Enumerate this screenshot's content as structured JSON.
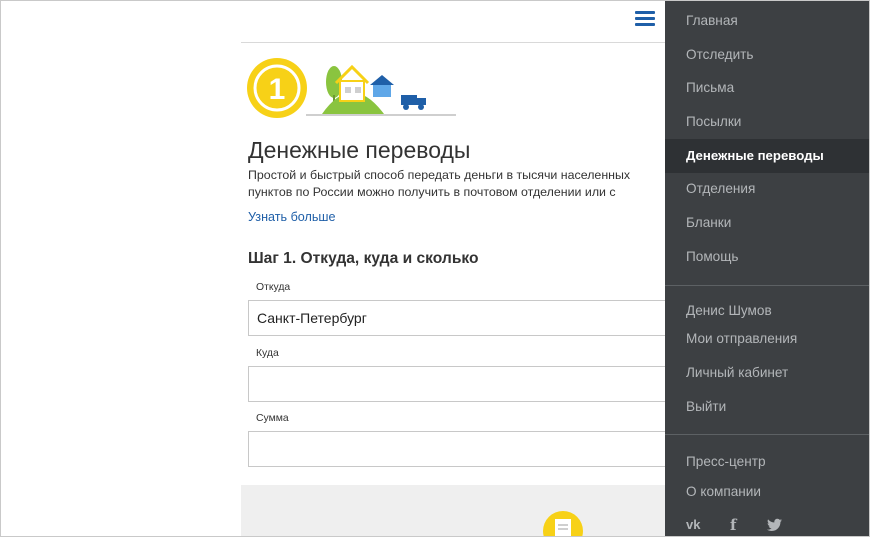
{
  "page": {
    "title": "Денежные переводы",
    "description": "Простой и быстрый способ передать деньги в тысячи населенных пунктов по России можно получить в почтовом отделении или с доставкой на дом",
    "learn_more": "Узнать больше",
    "step_heading": "Шаг 1. Откуда, куда и сколько"
  },
  "form": {
    "from": {
      "label": "Откуда",
      "value": "Санкт-Петербург",
      "placeholder": ""
    },
    "to": {
      "label": "Куда",
      "value": "",
      "placeholder": ""
    },
    "amount": {
      "label": "Сумма",
      "value": "",
      "placeholder": ""
    }
  },
  "hero": {
    "coin_digit": "1"
  },
  "nav": {
    "main_items": [
      {
        "label": "Главная",
        "active": false
      },
      {
        "label": "Отследить",
        "active": false
      },
      {
        "label": "Письма",
        "active": false
      },
      {
        "label": "Посылки",
        "active": false
      },
      {
        "label": "Денежные переводы",
        "active": true
      },
      {
        "label": "Отделения",
        "active": false
      },
      {
        "label": "Бланки",
        "active": false
      },
      {
        "label": "Помощь",
        "active": false
      }
    ],
    "user_items": [
      {
        "label": "Денис Шумов"
      },
      {
        "label": "Мои отправления"
      },
      {
        "label": "Личный кабинет"
      },
      {
        "label": "Выйти"
      }
    ],
    "info_items": [
      {
        "label": "Пресс-центр"
      },
      {
        "label": "О компании"
      }
    ],
    "social": {
      "vk": "vk",
      "facebook": "f"
    }
  },
  "colors": {
    "brand_blue": "#1f5fa8",
    "coin_yellow": "#f7d117",
    "drawer_bg": "#3d4043",
    "drawer_active_bg": "#2e3134",
    "drawer_text": "#b3b6b9"
  },
  "icons": {
    "menu": "hamburger-menu-icon",
    "vk": "vk-icon",
    "facebook": "facebook-icon",
    "twitter": "twitter-icon",
    "document": "document-icon"
  }
}
